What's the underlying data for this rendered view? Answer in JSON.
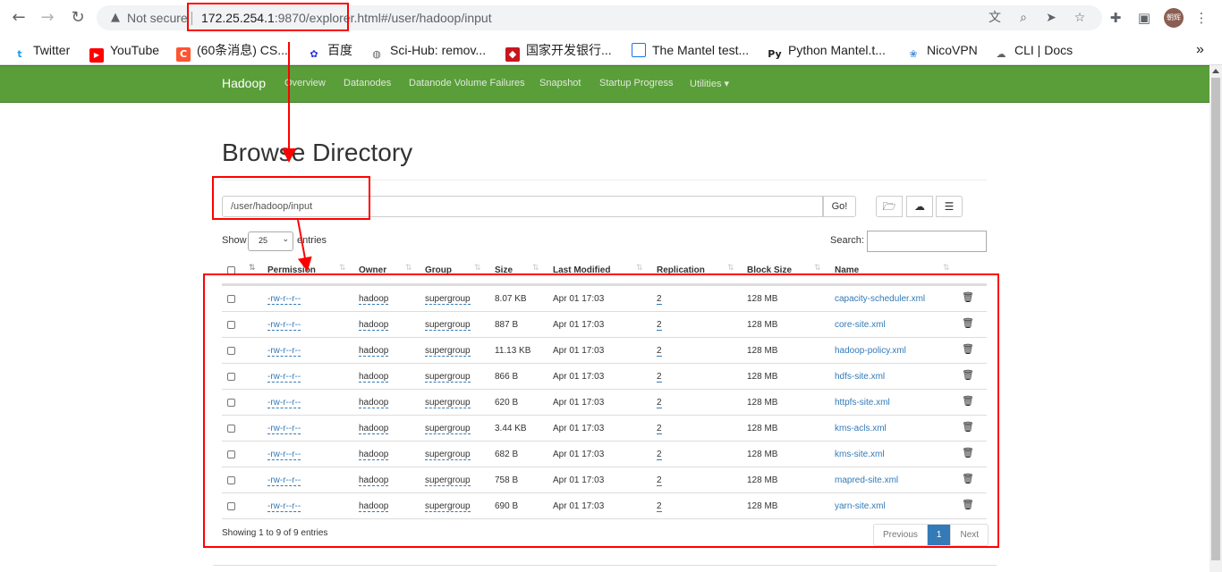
{
  "browser": {
    "not_secure": "Not secure",
    "url_host": "172.25.254.1",
    "url_rest": ":9870/explorer.html#/user/hadoop/input",
    "avatar_text": "朝辉",
    "bookmarks": [
      {
        "label": "Twitter",
        "icon": "twitter-icon"
      },
      {
        "label": "YouTube",
        "icon": "youtube-icon"
      },
      {
        "label": "(60条消息) CS...",
        "icon": "csdn-icon"
      },
      {
        "label": "百度",
        "icon": "baidu-icon"
      },
      {
        "label": "Sci-Hub: remov...",
        "icon": "globe-icon"
      },
      {
        "label": "国家开发银行...",
        "icon": "bank-icon"
      },
      {
        "label": "The Mantel test...",
        "icon": "page-icon"
      },
      {
        "label": "Python Mantel.t...",
        "icon": "pypi-icon"
      },
      {
        "label": "NicoVPN",
        "icon": "vpn-icon"
      },
      {
        "label": "CLI | Docs",
        "icon": "cloud-icon"
      }
    ],
    "more": "»"
  },
  "navbar": {
    "brand": "Hadoop",
    "links": [
      "Overview",
      "Datanodes",
      "Datanode Volume Failures",
      "Snapshot",
      "Startup Progress",
      "Utilities ▾"
    ]
  },
  "page": {
    "title": "Browse Directory",
    "path_value": "/user/hadoop/input",
    "go_label": "Go!",
    "show_label": "Show",
    "page_length": "25",
    "entries_label": "entries",
    "search_label": "Search:",
    "columns": [
      "Permission",
      "Owner",
      "Group",
      "Size",
      "Last Modified",
      "Replication",
      "Block Size",
      "Name"
    ],
    "rows": [
      {
        "permission": "-rw-r--r--",
        "owner": "hadoop",
        "group": "supergroup",
        "size": "8.07 KB",
        "modified": "Apr 01 17:03",
        "replication": "2",
        "block": "128 MB",
        "name": "capacity-scheduler.xml"
      },
      {
        "permission": "-rw-r--r--",
        "owner": "hadoop",
        "group": "supergroup",
        "size": "887 B",
        "modified": "Apr 01 17:03",
        "replication": "2",
        "block": "128 MB",
        "name": "core-site.xml"
      },
      {
        "permission": "-rw-r--r--",
        "owner": "hadoop",
        "group": "supergroup",
        "size": "11.13 KB",
        "modified": "Apr 01 17:03",
        "replication": "2",
        "block": "128 MB",
        "name": "hadoop-policy.xml"
      },
      {
        "permission": "-rw-r--r--",
        "owner": "hadoop",
        "group": "supergroup",
        "size": "866 B",
        "modified": "Apr 01 17:03",
        "replication": "2",
        "block": "128 MB",
        "name": "hdfs-site.xml"
      },
      {
        "permission": "-rw-r--r--",
        "owner": "hadoop",
        "group": "supergroup",
        "size": "620 B",
        "modified": "Apr 01 17:03",
        "replication": "2",
        "block": "128 MB",
        "name": "httpfs-site.xml"
      },
      {
        "permission": "-rw-r--r--",
        "owner": "hadoop",
        "group": "supergroup",
        "size": "3.44 KB",
        "modified": "Apr 01 17:03",
        "replication": "2",
        "block": "128 MB",
        "name": "kms-acls.xml"
      },
      {
        "permission": "-rw-r--r--",
        "owner": "hadoop",
        "group": "supergroup",
        "size": "682 B",
        "modified": "Apr 01 17:03",
        "replication": "2",
        "block": "128 MB",
        "name": "kms-site.xml"
      },
      {
        "permission": "-rw-r--r--",
        "owner": "hadoop",
        "group": "supergroup",
        "size": "758 B",
        "modified": "Apr 01 17:03",
        "replication": "2",
        "block": "128 MB",
        "name": "mapred-site.xml"
      },
      {
        "permission": "-rw-r--r--",
        "owner": "hadoop",
        "group": "supergroup",
        "size": "690 B",
        "modified": "Apr 01 17:03",
        "replication": "2",
        "block": "128 MB",
        "name": "yarn-site.xml"
      }
    ],
    "info": "Showing 1 to 9 of 9 entries",
    "pager": {
      "previous": "Previous",
      "current": "1",
      "next": "Next"
    }
  },
  "colors": {
    "navbar": "#5a9e3a",
    "link": "#337ab7",
    "annotation": "#ff0000"
  }
}
